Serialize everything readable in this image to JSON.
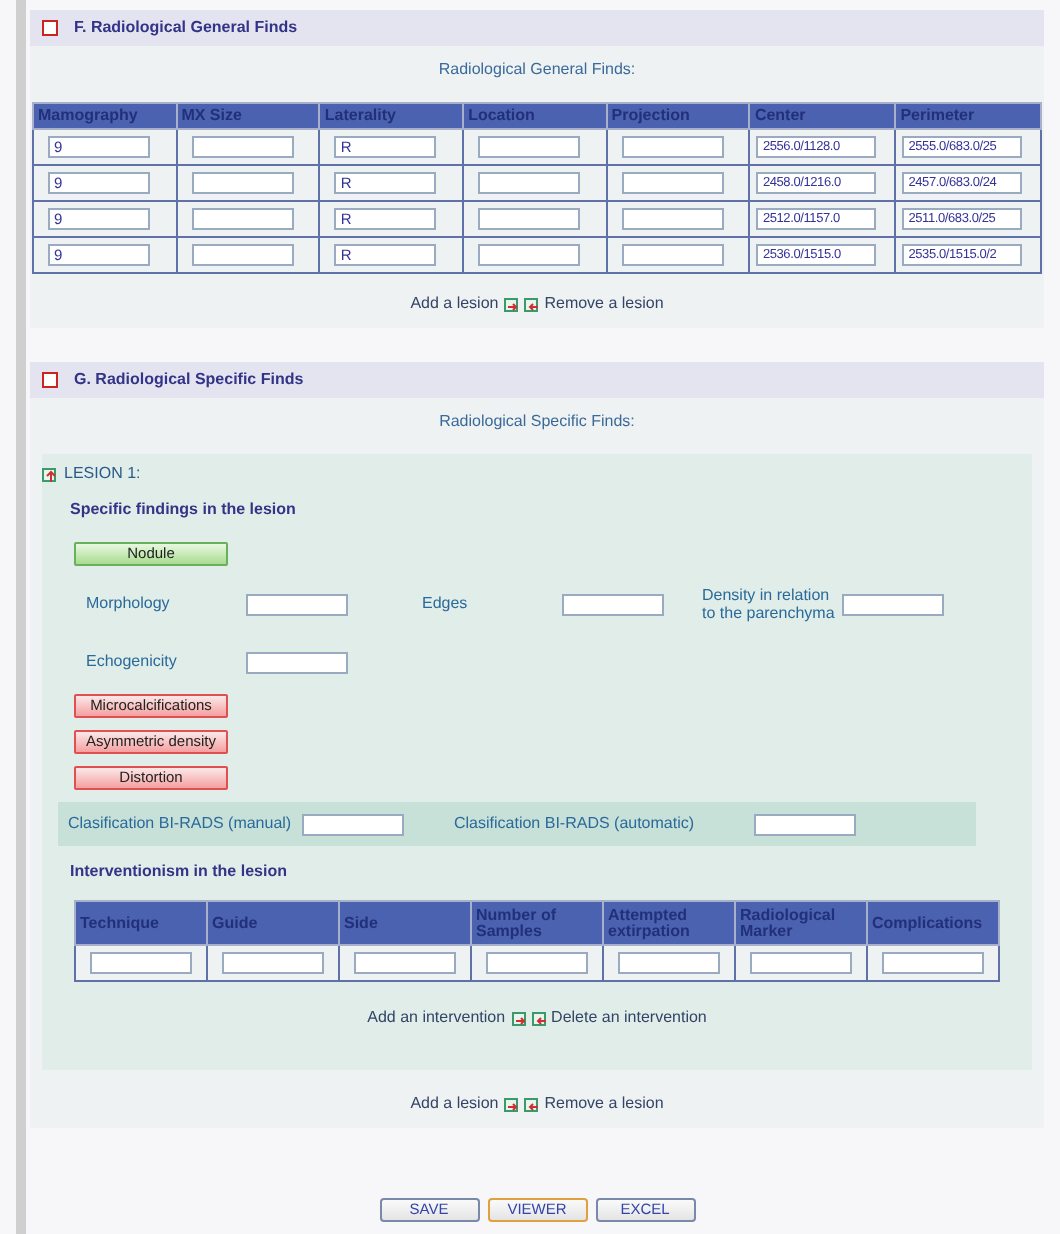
{
  "section_f": {
    "checked": false,
    "title": "F.  Radiological General Finds",
    "subtitle": "Radiological General Finds:",
    "columns": [
      "Mamography",
      "MX Size",
      "Laterality",
      "Location",
      "Projection",
      "Center",
      "Perimeter"
    ],
    "rows": [
      [
        "9",
        "",
        "R",
        "",
        "",
        "2556.0/1128.0",
        "2555.0/683.0/25"
      ],
      [
        "9",
        "",
        "R",
        "",
        "",
        "2458.0/1216.0",
        "2457.0/683.0/24"
      ],
      [
        "9",
        "",
        "R",
        "",
        "",
        "2512.0/1157.0",
        "2511.0/683.0/25"
      ],
      [
        "9",
        "",
        "R",
        "",
        "",
        "2536.0/1515.0",
        "2535.0/1515.0/2"
      ]
    ],
    "add_label": "Add a lesion",
    "remove_label": "Remove a lesion"
  },
  "section_g": {
    "checked": false,
    "title": "G.  Radiological Specific Finds",
    "subtitle": "Radiological Specific Finds:",
    "lesion": {
      "title": "LESION 1:",
      "findings_heading": "Specific findings in the lesion",
      "finding_types": [
        {
          "label": "Nodule",
          "selected": true
        },
        {
          "label": "Microcalcifications",
          "selected": false
        },
        {
          "label": "Asymmetric density",
          "selected": false
        },
        {
          "label": "Distortion",
          "selected": false
        }
      ],
      "nodule_fields": [
        {
          "label": "Morphology"
        },
        {
          "label": "Edges"
        },
        {
          "label": "Density in relation to the parenchyma"
        },
        {
          "label": "Echogenicity"
        }
      ],
      "birads": [
        {
          "label": "Clasification BI-RADS (manual)"
        },
        {
          "label": "Clasification BI-RADS (automatic)"
        }
      ],
      "intervention_heading": "Interventionism in the lesion",
      "intervention_columns": [
        "Technique",
        "Guide",
        "Side",
        "Number of Samples",
        "Attempted extirpation",
        "Radiological Marker",
        "Complications"
      ],
      "intervention_rows": [
        [
          "",
          "",
          "",
          "",
          "",
          "",
          ""
        ]
      ],
      "add_label": "Add an intervention",
      "remove_label": "Delete an intervention"
    },
    "add_label": "Add a lesion",
    "remove_label": "Remove a lesion"
  },
  "buttons": [
    {
      "label": "SAVE",
      "focused": false
    },
    {
      "label": "VIEWER",
      "focused": true
    },
    {
      "label": "EXCEL",
      "focused": false
    }
  ]
}
